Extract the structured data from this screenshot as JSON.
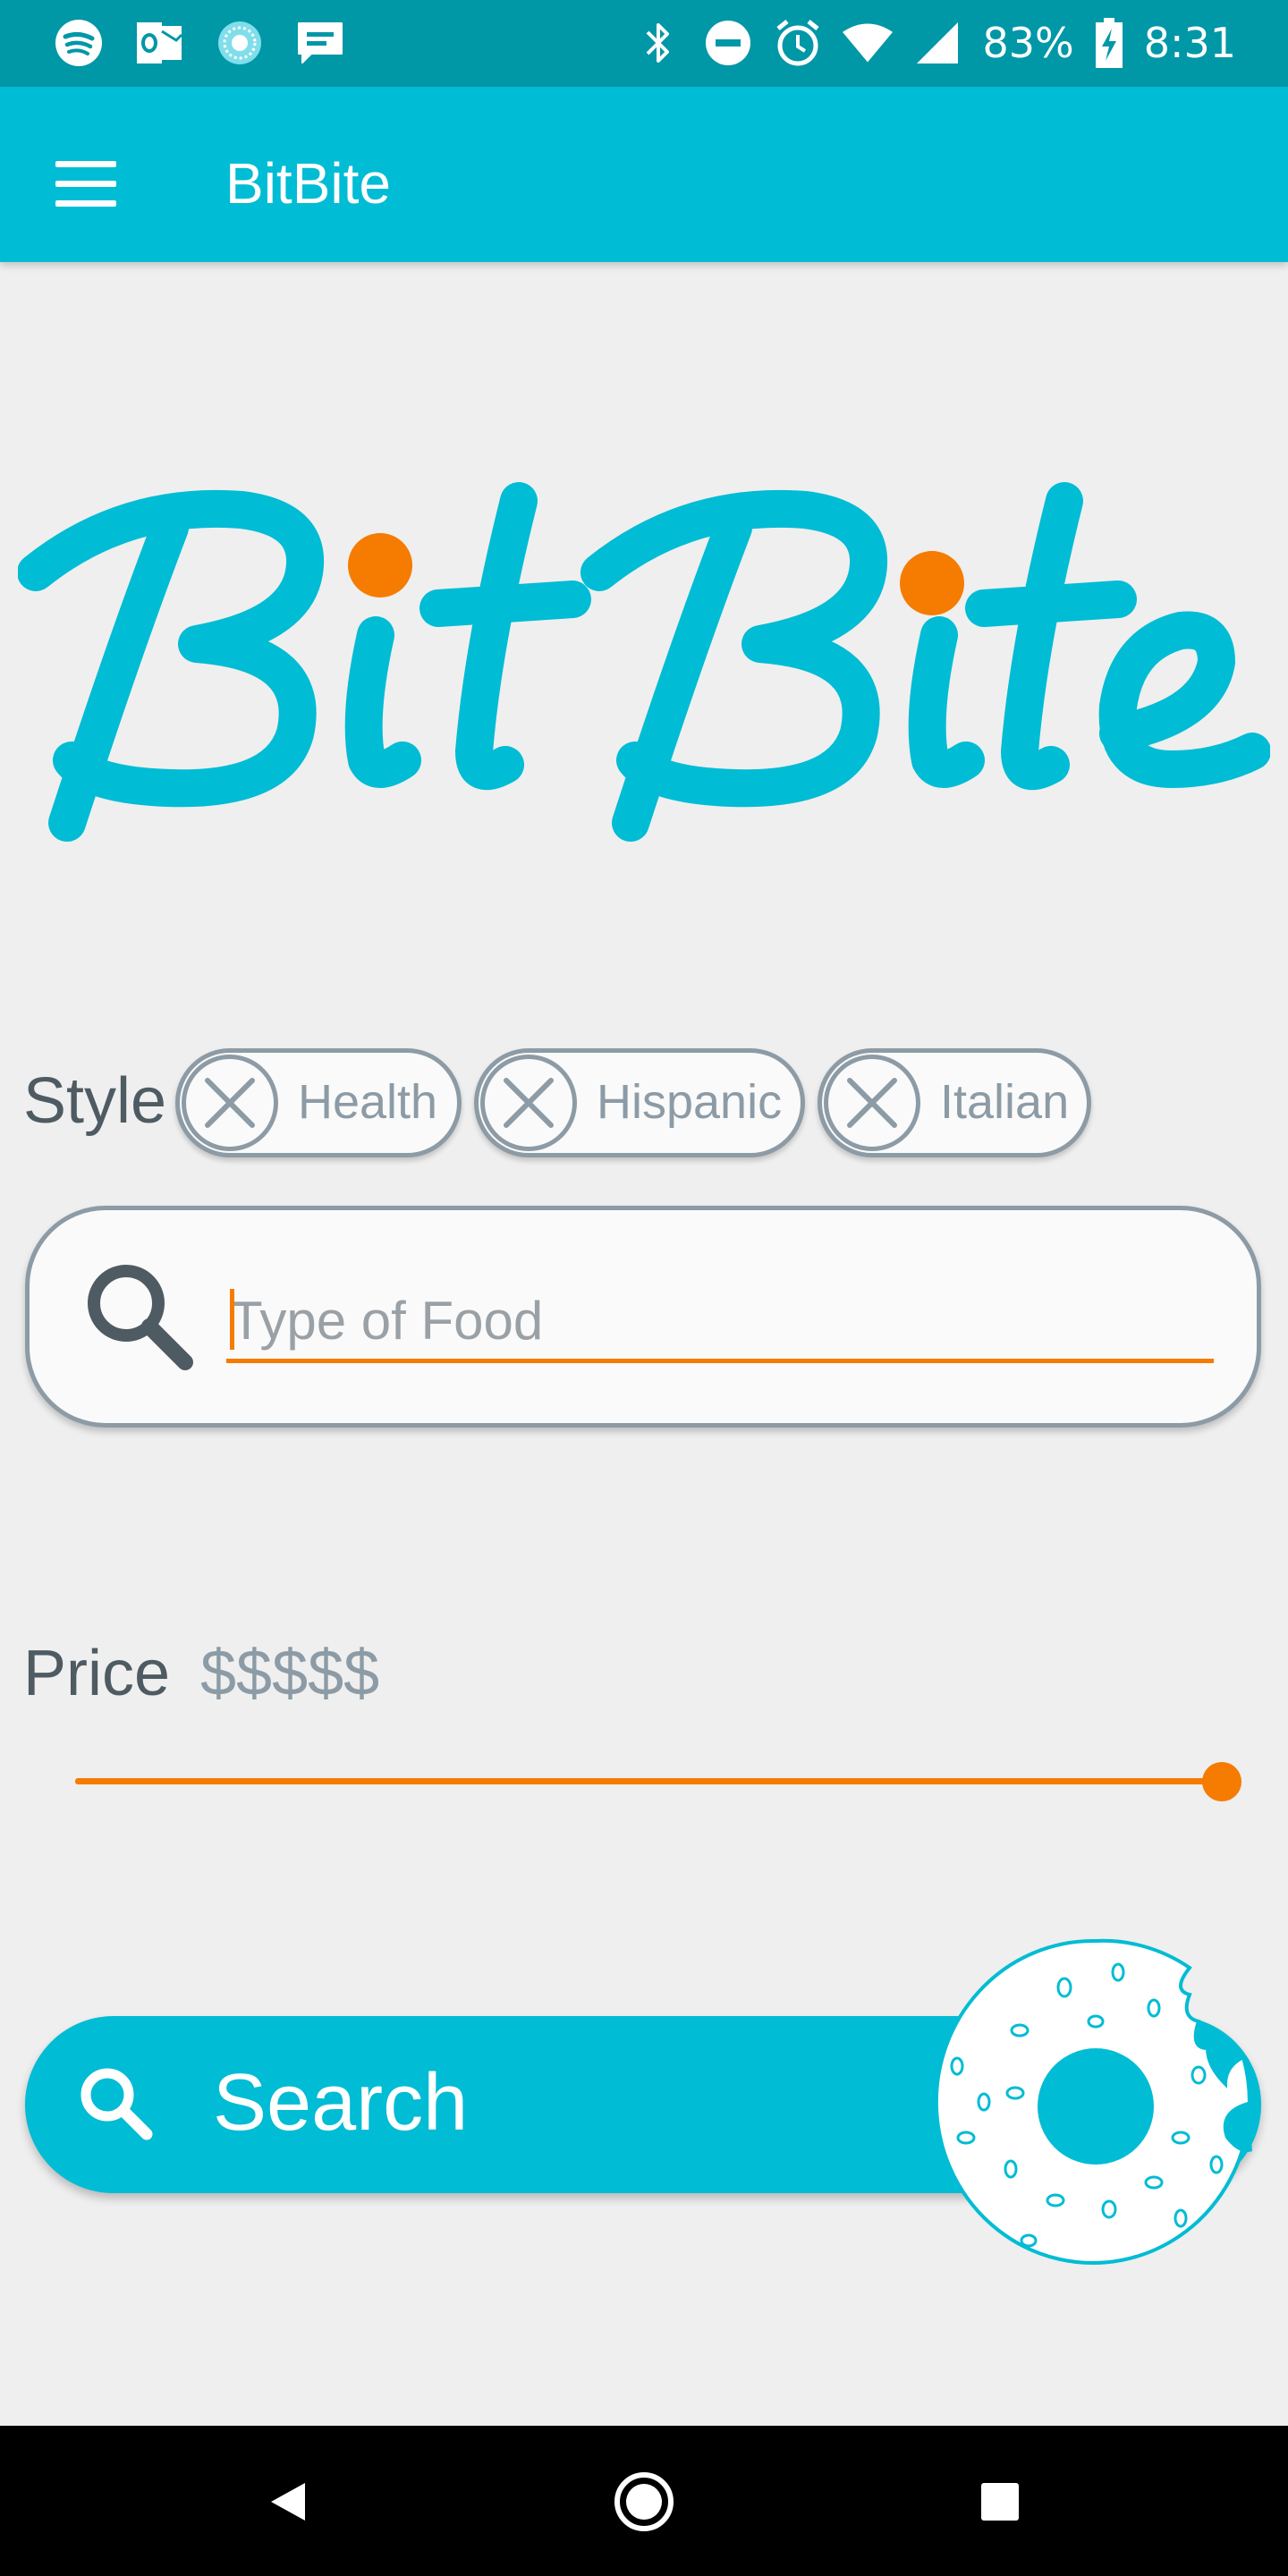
{
  "status_bar": {
    "battery": "83%",
    "time": "8:31",
    "left_icons": [
      "spotify-icon",
      "outlook-icon",
      "app-icon",
      "messages-icon"
    ],
    "right_icons": [
      "bluetooth-icon",
      "do-not-disturb-icon",
      "alarm-icon",
      "wifi-icon",
      "signal-icon",
      "battery-charging-icon"
    ]
  },
  "app_bar": {
    "title": "BitBite",
    "menu_icon": "hamburger-menu-icon"
  },
  "logo": {
    "text": "BitBite",
    "color": "#00bcd4",
    "dot_color": "#f57c00"
  },
  "style_filter": {
    "label": "Style",
    "chips": [
      {
        "label": "Health"
      },
      {
        "label": "Hispanic"
      },
      {
        "label": "Italian"
      }
    ]
  },
  "food_search": {
    "value": "",
    "placeholder": "Type of Food"
  },
  "price": {
    "label": "Price",
    "value": "$$$$$",
    "slider_fraction": 1.0
  },
  "search_button": {
    "label": "Search"
  },
  "colors": {
    "primary": "#00bcd4",
    "primary_dark": "#0097a7",
    "accent": "#f57c00",
    "muted": "#8c9ba5"
  }
}
